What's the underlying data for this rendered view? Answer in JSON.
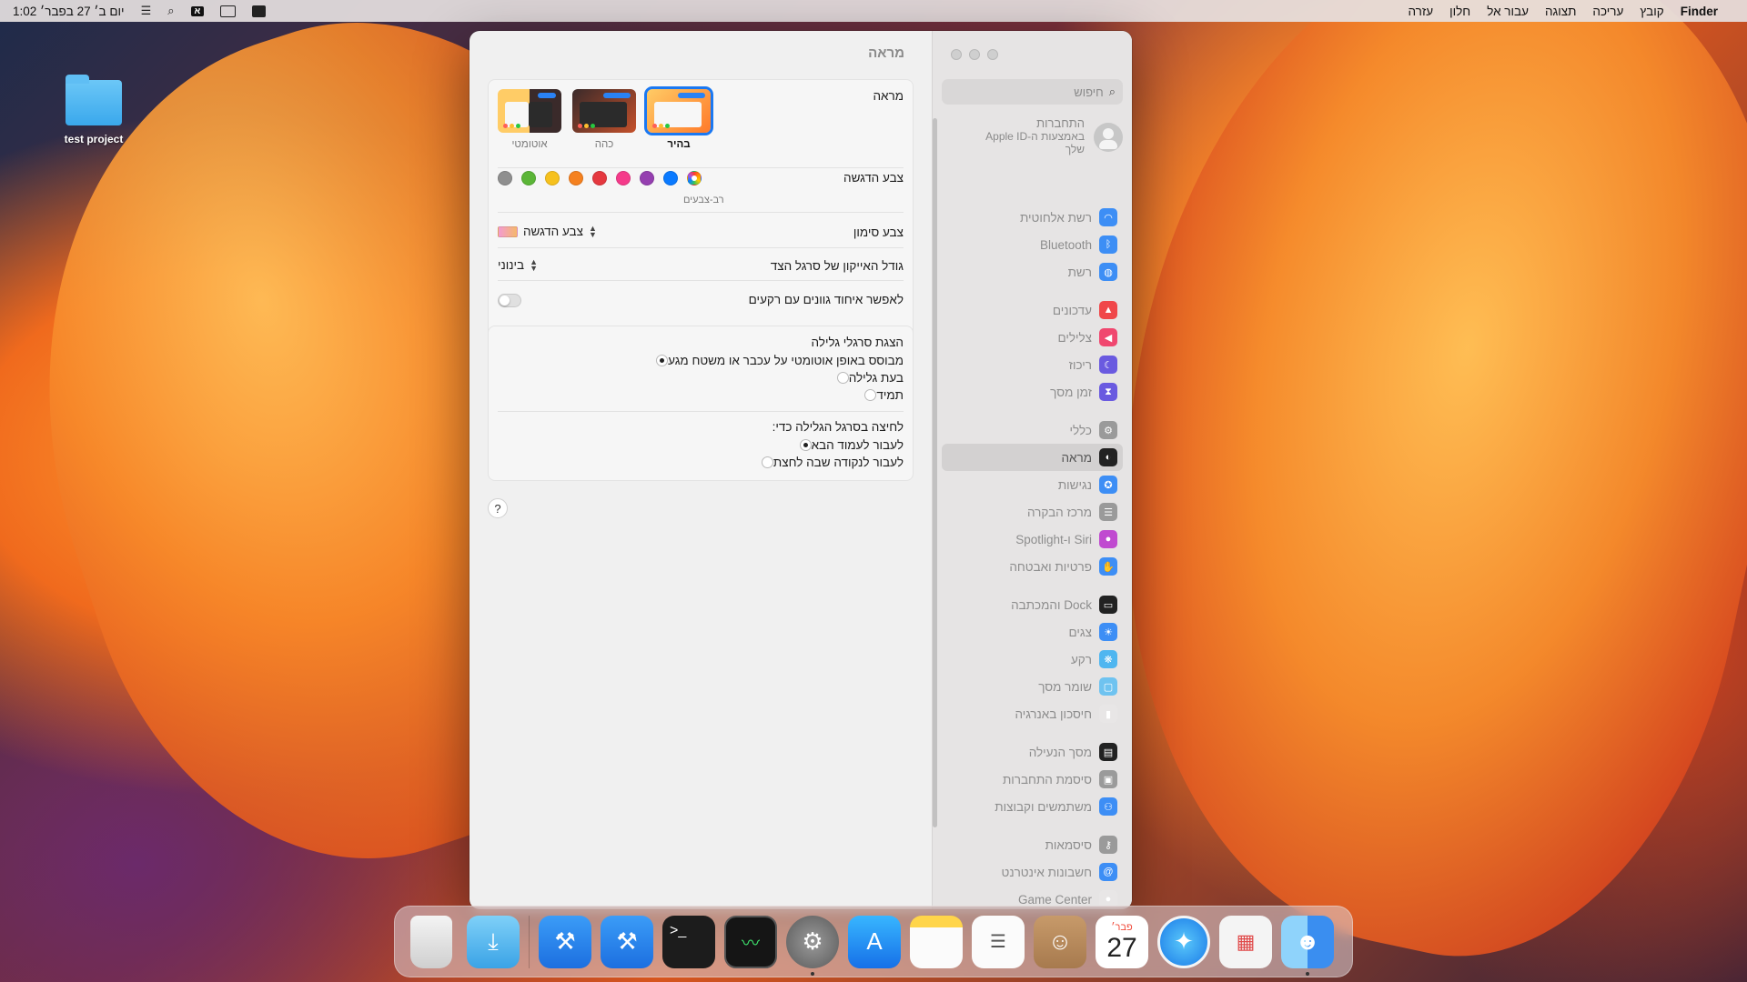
{
  "menubar": {
    "apple": "",
    "app": "Finder",
    "menus": [
      "קובץ",
      "עריכה",
      "תצוגה",
      "עבור אל",
      "חלון",
      "עזרה"
    ],
    "clock": "יום ב׳ 27 בפבר׳  1:02",
    "input_source": "א"
  },
  "desktop": {
    "folder_label": "test project"
  },
  "window": {
    "title": "מראה",
    "search_placeholder": "חיפוש",
    "account": {
      "line1": "התחברות",
      "line2": "באמצעות ה-Apple ID",
      "line3": "שלך"
    },
    "sidebar": [
      {
        "label": "רשת אלחוטית",
        "icon": "wifi-icon",
        "color": "#3d8ef5"
      },
      {
        "label": "Bluetooth",
        "icon": "bluetooth-icon",
        "color": "#3d8ef5"
      },
      {
        "label": "רשת",
        "icon": "globe-icon",
        "color": "#3d8ef5"
      },
      {
        "label": "עדכונים",
        "icon": "bell-icon",
        "color": "#f0474a"
      },
      {
        "label": "צלילים",
        "icon": "speaker-icon",
        "color": "#f0476f"
      },
      {
        "label": "ריכוז",
        "icon": "moon-icon",
        "color": "#6a5ae0"
      },
      {
        "label": "זמן מסך",
        "icon": "hourglass-icon",
        "color": "#6a5ae0"
      },
      {
        "label": "כללי",
        "icon": "gear-icon",
        "color": "#9a9a9a"
      },
      {
        "label": "מראה",
        "icon": "appearance-icon",
        "color": "#222222"
      },
      {
        "label": "נגישות",
        "icon": "accessibility-icon",
        "color": "#3d8ef5"
      },
      {
        "label": "מרכז הבקרה",
        "icon": "control-center-icon",
        "color": "#9a9a9a"
      },
      {
        "label": "Siri ו-Spotlight",
        "icon": "siri-icon",
        "color": "#c04ad0"
      },
      {
        "label": "פרטיות ואבטחה",
        "icon": "hand-icon",
        "color": "#3d8ef5"
      },
      {
        "label": "Dock והמכתבה",
        "icon": "dock-icon",
        "color": "#222222"
      },
      {
        "label": "צגים",
        "icon": "sun-icon",
        "color": "#3d8ef5"
      },
      {
        "label": "רקע",
        "icon": "wallpaper-icon",
        "color": "#4fb6f0"
      },
      {
        "label": "שומר מסך",
        "icon": "screensaver-icon",
        "color": "#6fc3f0"
      },
      {
        "label": "חיסכון באנרגיה",
        "icon": "battery-icon",
        "color": "#e8e6e6"
      },
      {
        "label": "מסך הנעילה",
        "icon": "lock-icon",
        "color": "#222222"
      },
      {
        "label": "סיסמת התחברות",
        "icon": "padlock-icon",
        "color": "#9a9a9a"
      },
      {
        "label": "משתמשים וקבוצות",
        "icon": "users-icon",
        "color": "#3d8ef5"
      },
      {
        "label": "סיסמאות",
        "icon": "key-icon",
        "color": "#9a9a9a"
      },
      {
        "label": "חשבונות אינטרנט",
        "icon": "at-icon",
        "color": "#3d8ef5"
      },
      {
        "label": "Game Center",
        "icon": "game-center-icon",
        "color": "#e8e6e6"
      }
    ],
    "appearance": {
      "label": "מראה",
      "options": [
        {
          "caption": "בהיר",
          "selected": true
        },
        {
          "caption": "כהה",
          "selected": false
        },
        {
          "caption": "אוטומטי",
          "selected": false
        }
      ]
    },
    "accent": {
      "label": "צבע הדגשה",
      "multicolor_label": "רב-צבעים",
      "colors": [
        "multicolor",
        "#0a7aff",
        "#953fb0",
        "#f53a8a",
        "#e5383f",
        "#f5811f",
        "#f6c11d",
        "#5bb537",
        "#8f8f8f"
      ]
    },
    "highlight": {
      "label": "צבע סימון",
      "value": "צבע הדגשה"
    },
    "sidebar_icon_size": {
      "label": "גודל האייקון של סרגל הצד",
      "value": "בינוני"
    },
    "wallpaper_tinting": {
      "label": "לאפשר איחוד גוונים עם רקעים",
      "on": false
    },
    "scroll_bars": {
      "heading": "הצגת סרגלי גלילה",
      "options": [
        {
          "label": "מבוסס באופן אוטומטי על עכבר או משטח מגע",
          "checked": true
        },
        {
          "label": "בעת גלילה",
          "checked": false
        },
        {
          "label": "תמיד",
          "checked": false
        }
      ]
    },
    "click_scroll": {
      "heading": "לחיצה בסרגל הגלילה כדי:",
      "options": [
        {
          "label": "לעבור לעמוד הבא",
          "checked": true
        },
        {
          "label": "לעבור לנקודה שבה לחצת",
          "checked": false
        }
      ]
    },
    "help": "?"
  },
  "dock": {
    "calendar_month": "פבר׳",
    "calendar_day": "27"
  }
}
